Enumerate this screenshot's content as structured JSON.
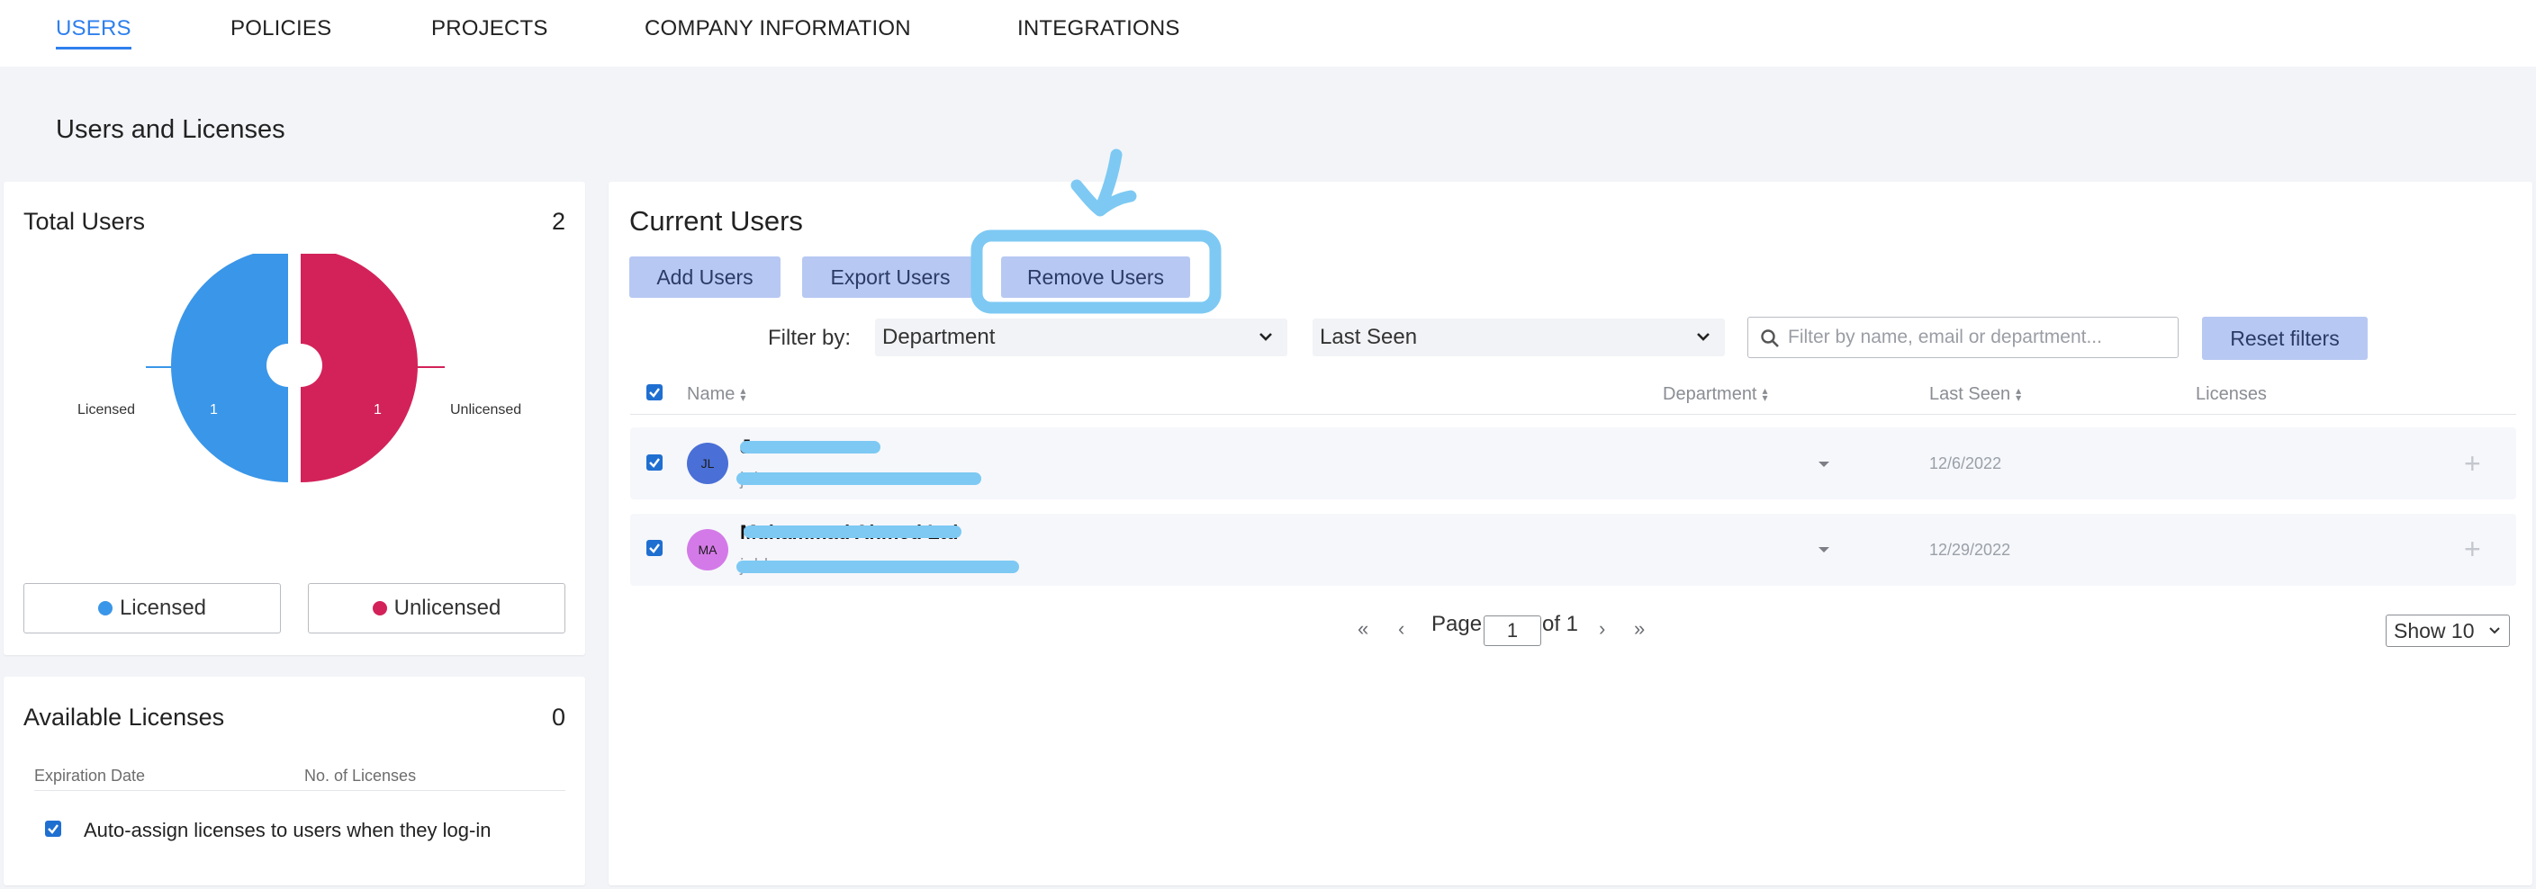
{
  "nav": {
    "tabs": [
      {
        "label": "USERS",
        "active": true
      },
      {
        "label": "POLICIES"
      },
      {
        "label": "PROJECTS"
      },
      {
        "label": "COMPANY INFORMATION"
      },
      {
        "label": "INTEGRATIONS"
      }
    ]
  },
  "page_title": "Users and Licenses",
  "total_users": {
    "title": "Total Users",
    "count": "2",
    "chart": {
      "licensed_label": "Licensed",
      "licensed_value": "1",
      "unlicensed_label": "Unlicensed",
      "unlicensed_value": "1"
    },
    "legend": {
      "licensed": "Licensed",
      "unlicensed": "Unlicensed"
    },
    "colors": {
      "licensed": "#3a96e8",
      "unlicensed": "#d3225a"
    }
  },
  "available_licenses": {
    "title": "Available Licenses",
    "count": "0",
    "col_expiration": "Expiration Date",
    "col_no_licenses": "No. of Licenses",
    "auto_assign_label": "Auto-assign licenses to users when they log-in"
  },
  "current_users": {
    "title": "Current Users",
    "add_button": "Add Users",
    "export_button": "Export Users",
    "remove_button": "Remove Users",
    "filter_by_label": "Filter by:",
    "department_select": "Department",
    "last_seen_select": "Last Seen",
    "search_placeholder": "Filter by name, email or department...",
    "reset_button": "Reset filters",
    "columns": {
      "name": "Name",
      "department": "Department",
      "last_seen": "Last Seen",
      "licenses": "Licenses"
    },
    "rows": [
      {
        "initials": "JL",
        "avatar_color": "#4a6fd6",
        "name": "Ja",
        "email": "jako",
        "last_seen": "12/6/2022"
      },
      {
        "initials": "MA",
        "avatar_color": "#d47ae8",
        "name": "Muhammad Ahmed Ltd",
        "email": "jabba",
        "last_seen": "12/29/2022"
      }
    ],
    "pagination": {
      "page_label": "Page",
      "page": "1",
      "of_label": "of 1",
      "show": "Show 10"
    }
  },
  "accent_color": "#2f80ed",
  "annotation_color": "#7dc9f3"
}
